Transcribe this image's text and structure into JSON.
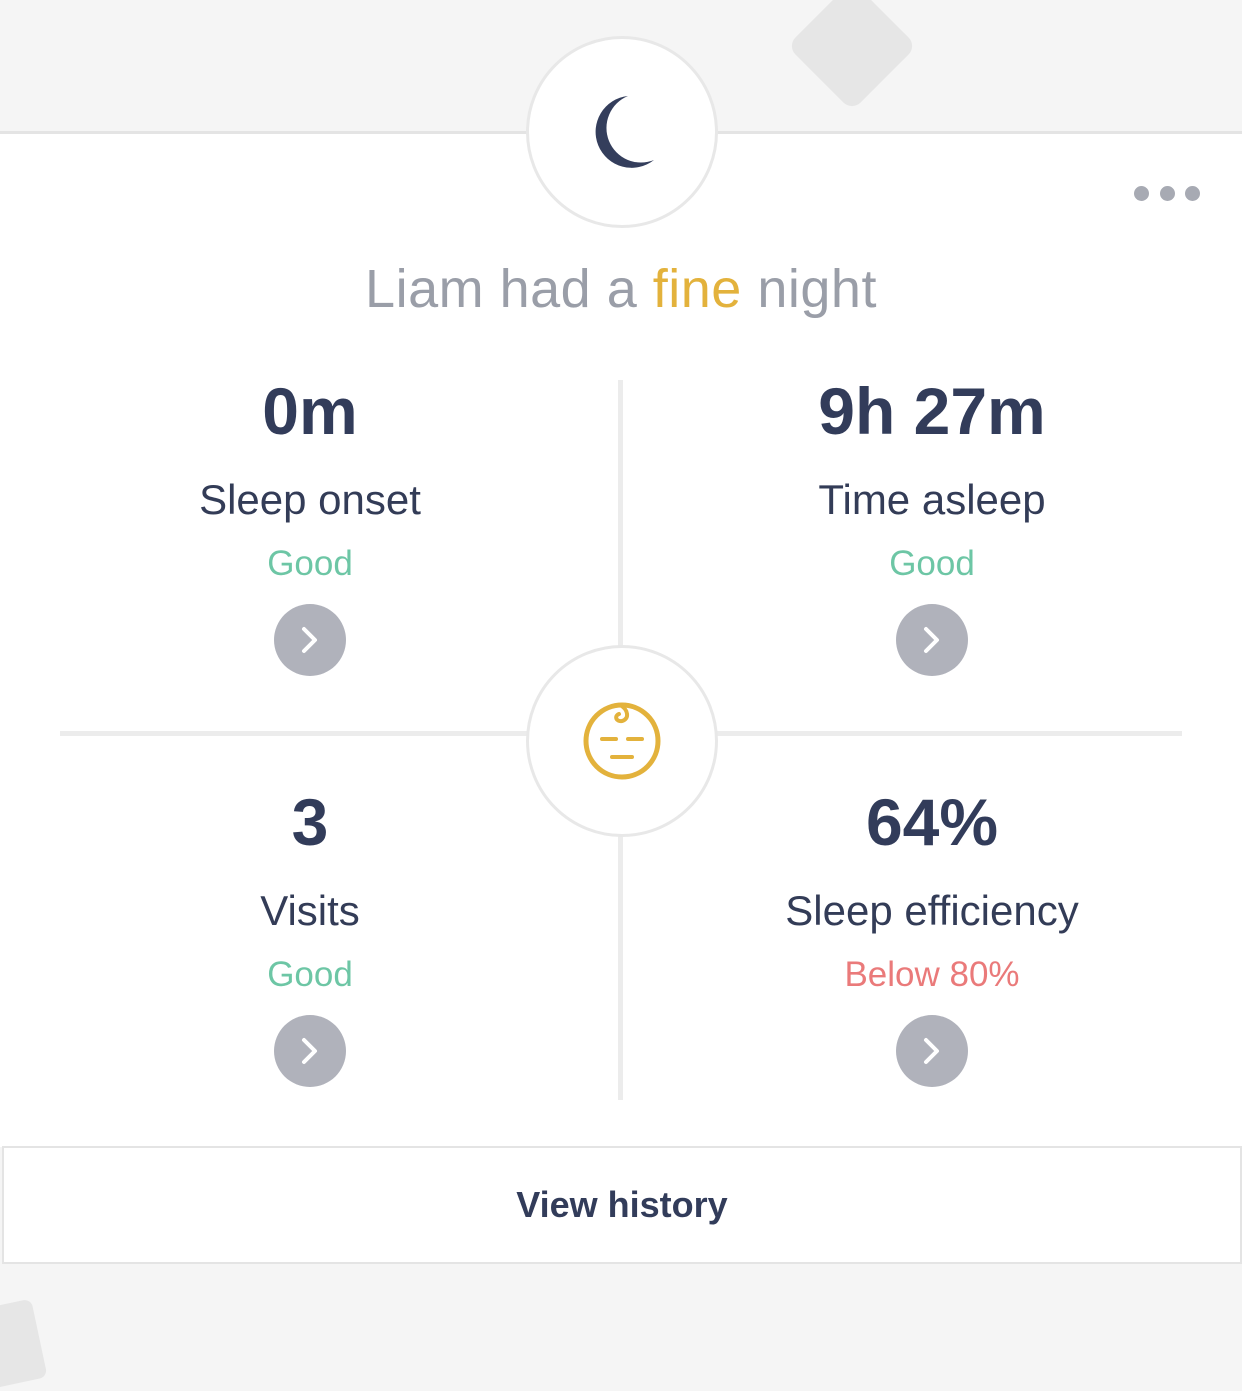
{
  "header": {
    "moon_icon": "moon-icon",
    "more_icon": "more-horizontal-icon"
  },
  "headline": {
    "prefix": "Liam had a",
    "quality": "fine",
    "suffix": "night"
  },
  "center_icon": "sleeping-baby-face-icon",
  "metrics": [
    {
      "value": "0m",
      "label": "Sleep onset",
      "status": "Good",
      "status_type": "good"
    },
    {
      "value": "9h 27m",
      "label": "Time asleep",
      "status": "Good",
      "status_type": "good"
    },
    {
      "value": "3",
      "label": "Visits",
      "status": "Good",
      "status_type": "good"
    },
    {
      "value": "64%",
      "label": "Sleep efficiency",
      "status": "Below 80%",
      "status_type": "bad"
    }
  ],
  "history_button": {
    "label": "View history"
  },
  "colors": {
    "accent_yellow": "#e3b23c",
    "good_green": "#6dc6a5",
    "bad_red": "#ea7a7a",
    "navy_text": "#323c5a",
    "gray_button": "#b0b2bb"
  }
}
